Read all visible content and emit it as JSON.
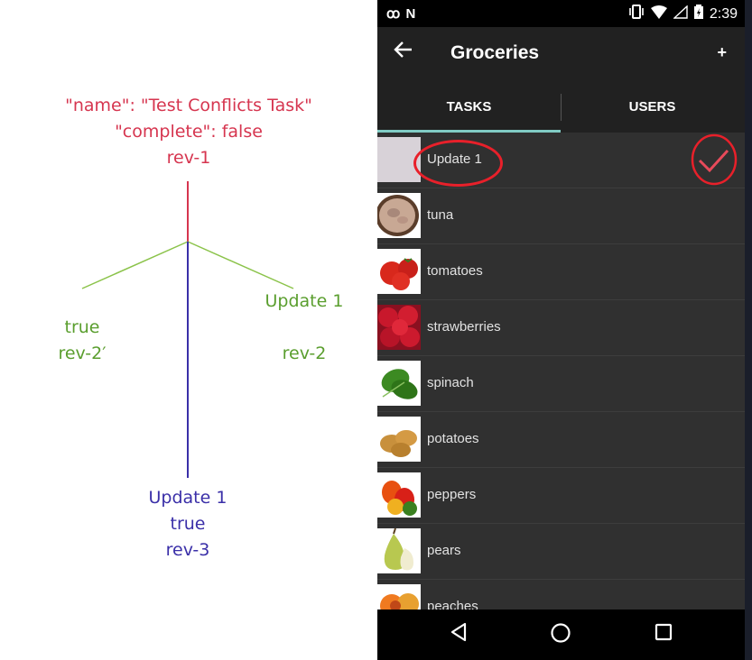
{
  "diagram": {
    "root": {
      "line1": "\"name\": \"Test Conflicts Task\"",
      "line2": "\"complete\": false",
      "line3": "rev-1"
    },
    "left_branch": {
      "line1": "true",
      "line2": "rev-2′"
    },
    "right_branch": {
      "line1": "Update 1",
      "line2": "rev-2"
    },
    "bottom": {
      "line1": "Update 1",
      "line2": "true",
      "line3": "rev-3"
    },
    "colors": {
      "red": "#d6354f",
      "green": "#5a9e2e",
      "blue": "#3a2fa8"
    }
  },
  "status_bar": {
    "time": "2:39",
    "left_icons": "ꝏ N"
  },
  "toolbar": {
    "title": "Groceries",
    "back_icon": "arrow-left-icon",
    "add_label": "+"
  },
  "tabs": [
    {
      "label": "TASKS"
    },
    {
      "label": "USERS"
    }
  ],
  "tasks": [
    {
      "label": "Update 1",
      "image": "blank-image",
      "complete": true
    },
    {
      "label": "tuna",
      "image": "tuna-image"
    },
    {
      "label": "tomatoes",
      "image": "tomatoes-image"
    },
    {
      "label": "strawberries",
      "image": "strawberries-image"
    },
    {
      "label": "spinach",
      "image": "spinach-image"
    },
    {
      "label": "potatoes",
      "image": "potatoes-image"
    },
    {
      "label": "peppers",
      "image": "peppers-image"
    },
    {
      "label": "pears",
      "image": "pears-image"
    },
    {
      "label": "peaches",
      "image": "peaches-image"
    }
  ],
  "colors": {
    "accent": "#80cbc4",
    "annotation": "#e8202a",
    "background": "#303030"
  }
}
